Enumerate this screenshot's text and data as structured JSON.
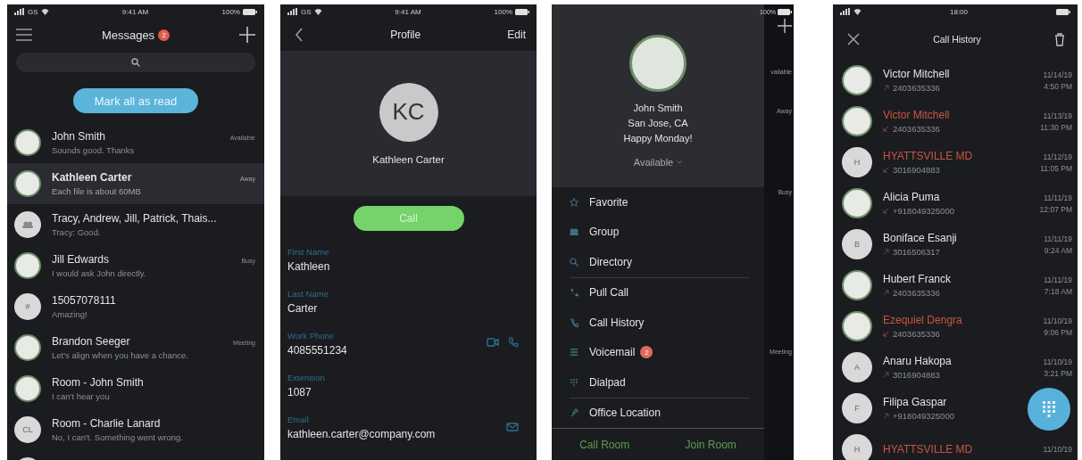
{
  "messages": {
    "status_bar": {
      "carrier": "GS",
      "time": "9:41 AM",
      "battery": "100%"
    },
    "title": "Messages",
    "badge": "2",
    "mark_all_button": "Mark all as read",
    "conversations": [
      {
        "name": "John Smith",
        "preview": "Sounds good. Thanks",
        "status": "Available",
        "avatar": {
          "kind": "photo"
        },
        "selected": false
      },
      {
        "name": "Kathleen Carter",
        "preview": "Each file is about 60MB",
        "status": "Away",
        "avatar": {
          "kind": "photo"
        },
        "selected": true
      },
      {
        "name": "Tracy, Andrew, Jill, Patrick, Thais...",
        "preview": "Tracy: Good.",
        "avatar": {
          "kind": "group"
        },
        "selected": false
      },
      {
        "name": "Jill Edwards",
        "preview": "I would ask John directly.",
        "status": "Busy",
        "avatar": {
          "kind": "photo"
        },
        "selected": false
      },
      {
        "name": "15057078111",
        "preview": "Amazing!",
        "avatar": {
          "kind": "initials",
          "text": "#"
        },
        "selected": false
      },
      {
        "name": "Brandon Seeger",
        "preview": "Let's align when you have a chance.",
        "status": "Meeting",
        "avatar": {
          "kind": "photo"
        },
        "selected": false
      },
      {
        "name": "Room - John Smith",
        "preview": "I can't hear you",
        "avatar": {
          "kind": "photo"
        },
        "selected": false
      },
      {
        "name": "Room - Charlie Lanard",
        "preview": "No, I can't. Something went wrong.",
        "avatar": {
          "kind": "initials",
          "text": "CL"
        },
        "selected": false
      }
    ]
  },
  "profile": {
    "status_bar": {
      "carrier": "GS",
      "time": "9:41 AM",
      "battery": "100%"
    },
    "title": "Profile",
    "edit": "Edit",
    "initials": "KC",
    "name": "Kathleen Carter",
    "call_button": "Call",
    "fields": [
      {
        "label": "First Name",
        "value": "Kathleen",
        "kind": "text"
      },
      {
        "label": "Last Name",
        "value": "Carter",
        "kind": "text"
      },
      {
        "label": "Work Phone",
        "value": "4085551234",
        "kind": "phone"
      },
      {
        "label": "Extension",
        "value": "1087",
        "kind": "text"
      },
      {
        "label": "Email",
        "value": "kathleen.carter@company.com",
        "kind": "email"
      }
    ]
  },
  "menu": {
    "battery": "100%",
    "background_statuses": [
      "vailable",
      "Away",
      "Busy",
      "Meeting"
    ],
    "user": {
      "name": "John Smith",
      "location": "San Jose, CA",
      "message": "Happy Monday!",
      "presence": "Available"
    },
    "sections": [
      [
        {
          "label": "Favorite"
        },
        {
          "label": "Group"
        },
        {
          "label": "Directory"
        }
      ],
      [
        {
          "label": "Pull Call"
        },
        {
          "label": "Call History"
        },
        {
          "label": "Voicemail",
          "badge": "2"
        },
        {
          "label": "Dialpad"
        }
      ],
      [
        {
          "label": "Office Location"
        }
      ]
    ],
    "footer": [
      "Call Room",
      "Join Room"
    ]
  },
  "call_history": {
    "status_bar": {
      "time": "18:00"
    },
    "title": "Call History",
    "calls": [
      {
        "name": "Victor Mitchell",
        "number": "2403635336",
        "kind": "outgoing",
        "missed": false,
        "date": "11/14/19",
        "time": "4:50 PM",
        "avatar": {
          "kind": "photo"
        }
      },
      {
        "name": "Victor Mitchell",
        "number": "2403635336",
        "kind": "incoming",
        "missed": true,
        "date": "11/13/19",
        "time": "11:30 PM",
        "avatar": {
          "kind": "photo"
        }
      },
      {
        "name": "HYATTSVILLE MD",
        "number": "3016904883",
        "kind": "incoming",
        "missed": true,
        "date": "11/12/19",
        "time": "11:05 PM",
        "avatar": {
          "kind": "initials",
          "text": "H"
        }
      },
      {
        "name": "Alicia Puma",
        "number": "+918049325000",
        "kind": "incoming",
        "missed": false,
        "date": "11/11/19",
        "time": "12:07 PM",
        "avatar": {
          "kind": "photo"
        }
      },
      {
        "name": "Boniface Esanji",
        "number": "3016506317",
        "kind": "outgoing",
        "missed": false,
        "date": "11/11/19",
        "time": "9:24 AM",
        "avatar": {
          "kind": "initials",
          "text": "B"
        }
      },
      {
        "name": "Hubert Franck",
        "number": "2403635336",
        "kind": "outgoing",
        "missed": false,
        "date": "11/11/19",
        "time": "7:18 AM",
        "avatar": {
          "kind": "photo"
        }
      },
      {
        "name": "Ezequiel Dengra",
        "number": "2403635336",
        "kind": "incoming",
        "missed": true,
        "date": "11/10/19",
        "time": "9:06 PM",
        "avatar": {
          "kind": "photo"
        }
      },
      {
        "name": "Anaru Hakopa",
        "number": "3016904883",
        "kind": "outgoing",
        "missed": false,
        "date": "11/10/19",
        "time": "3:21 PM",
        "avatar": {
          "kind": "initials",
          "text": "A"
        }
      },
      {
        "name": "Filipa Gaspar",
        "number": "+918049325000",
        "kind": "outgoing",
        "missed": false,
        "avatar": {
          "kind": "initials",
          "text": "F"
        }
      },
      {
        "name": "HYATTSVILLE MD",
        "missed": true,
        "date": "11/10/19",
        "avatar": {
          "kind": "initials",
          "text": "H"
        }
      }
    ]
  }
}
